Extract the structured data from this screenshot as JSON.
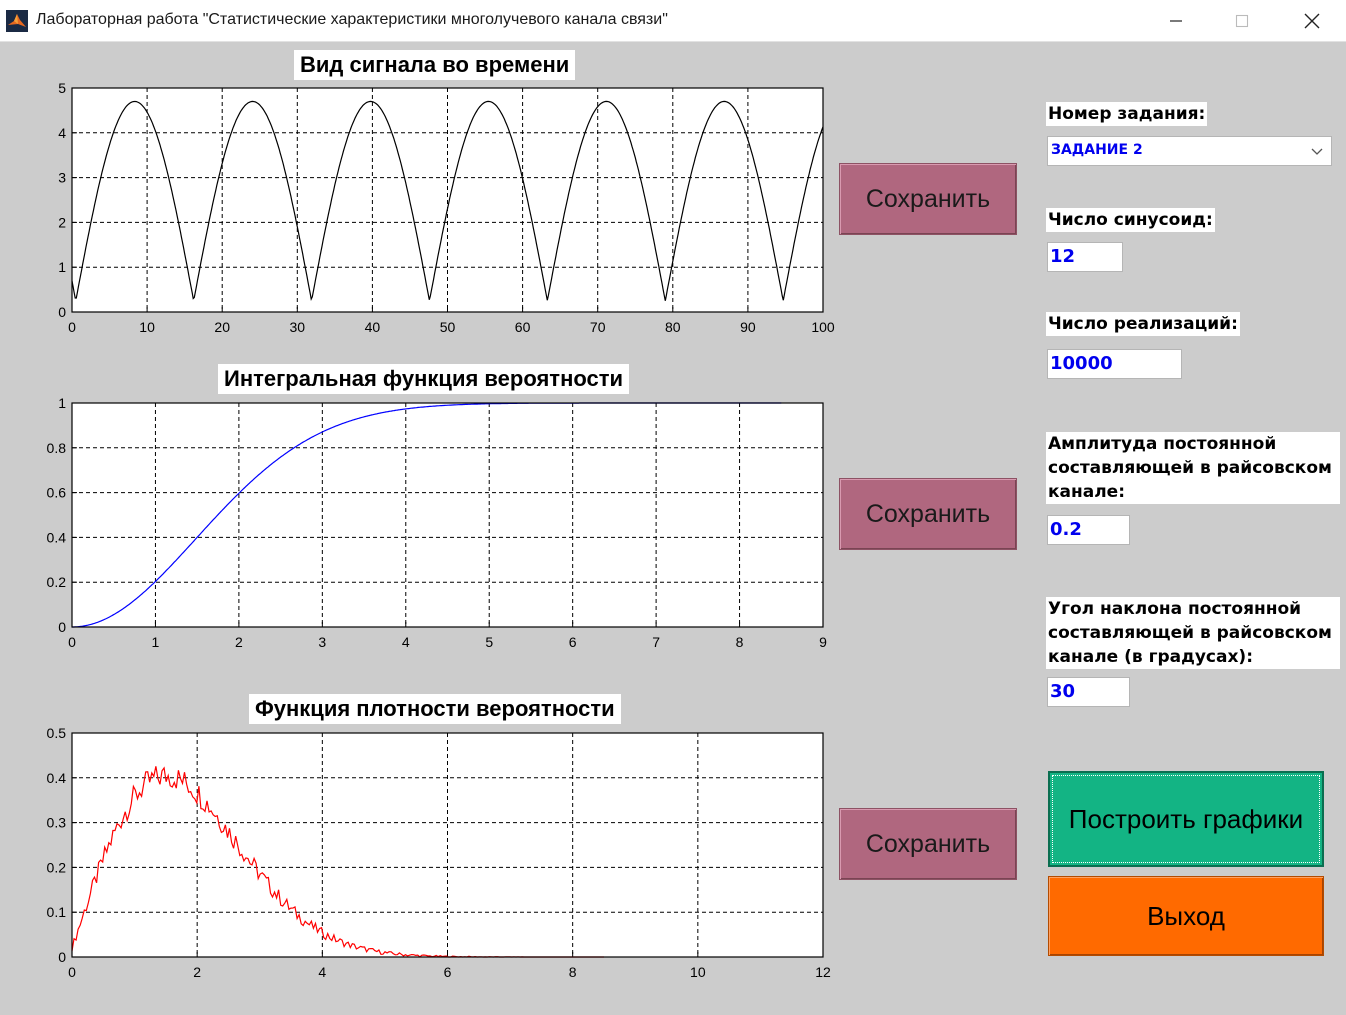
{
  "window": {
    "title": "Лабораторная работа \"Статистические характеристики многолучевого канала связи\""
  },
  "plots": [
    {
      "title": "Вид сигнала во времени",
      "color": "#000000",
      "xticks": [
        "0",
        "10",
        "20",
        "30",
        "40",
        "50",
        "60",
        "70",
        "80",
        "90",
        "100"
      ],
      "yticks": [
        "0",
        "1",
        "2",
        "3",
        "4",
        "5"
      ],
      "chart_data": {
        "type": "line",
        "xlim": [
          0,
          100
        ],
        "ylim": [
          0,
          5
        ],
        "grid": true
      }
    },
    {
      "title": "Интегральная функция вероятности",
      "color": "#0000ff",
      "xticks": [
        "0",
        "1",
        "2",
        "3",
        "4",
        "5",
        "6",
        "7",
        "8",
        "9"
      ],
      "yticks": [
        "0",
        "0.2",
        "0.4",
        "0.6",
        "0.8",
        "1"
      ],
      "chart_data": {
        "type": "line",
        "xlim": [
          0,
          9
        ],
        "ylim": [
          0,
          1
        ],
        "grid": true
      }
    },
    {
      "title": "Функция плотности вероятности",
      "color": "#ff0000",
      "xticks": [
        "0",
        "2",
        "4",
        "6",
        "8",
        "10",
        "12"
      ],
      "yticks": [
        "0",
        "0.1",
        "0.2",
        "0.3",
        "0.4",
        "0.5"
      ],
      "chart_data": {
        "type": "line",
        "xlim": [
          0,
          12
        ],
        "ylim": [
          0,
          0.5
        ],
        "grid": true
      }
    }
  ],
  "buttons": {
    "save": "Сохранить",
    "build": "Построить графики",
    "exit": "Выход"
  },
  "controls": {
    "task_label": "Номер задания:",
    "task_value": "ЗАДАНИЕ 2",
    "sinusoids_label": "Число синусоид:",
    "sinusoids_value": "12",
    "realizations_label": "Число реализаций:",
    "realizations_value": "10000",
    "amplitude_label": "Амплитуда постоянной составляющей в райсовском канале:",
    "amplitude_value": "0.2",
    "angle_label": "Угол наклона постоянной составляющей в райсовском канале (в градусах):",
    "angle_value": "30"
  },
  "colors": {
    "background": "#cccccc",
    "save_button": "#b0677f",
    "build_button": "#13b484",
    "exit_button": "#ff6a00",
    "input_text": "#0000ee"
  }
}
